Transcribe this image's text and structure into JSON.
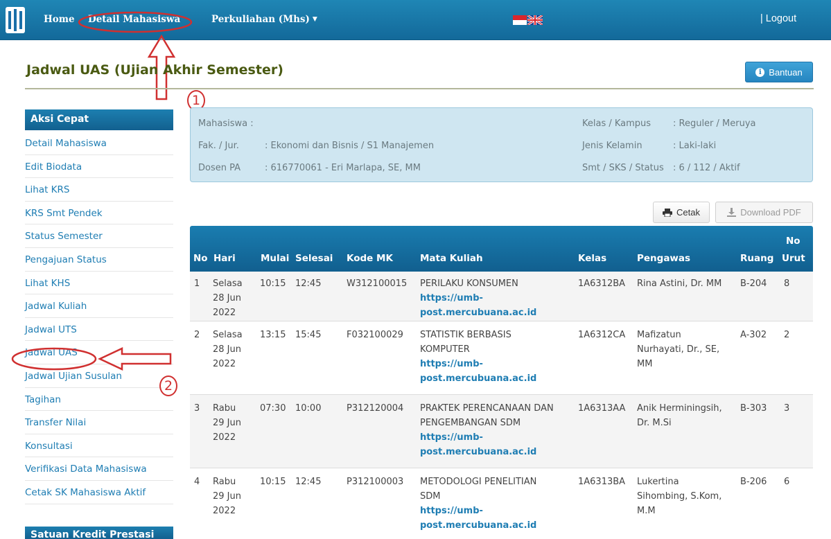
{
  "nav": {
    "home": "Home",
    "detail": "Detail Mahasiswa",
    "kuliah": "Perkuliahan (Mhs)",
    "logout": "| Logout"
  },
  "page": {
    "title": "Jadwal UAS (Ujian Akhir Semester)",
    "help": "Bantuan"
  },
  "annotations": {
    "one": "1",
    "two": "2"
  },
  "sidebar": {
    "heading": "Aksi Cepat",
    "items": [
      "Detail Mahasiswa",
      "Edit Biodata",
      "Lihat KRS",
      "KRS Smt Pendek",
      "Status Semester",
      "Pengajuan Status",
      "Lihat KHS",
      "Jadwal Kuliah",
      "Jadwal UTS",
      "Jadwal UAS",
      "Jadwal Ujian Susulan",
      "Tagihan",
      "Transfer Nilai",
      "Konsultasi",
      "Verifikasi Data Mahasiswa",
      "Cetak SK Mahasiswa Aktif"
    ],
    "heading2": "Satuan Kredit Prestasi"
  },
  "info": {
    "mahasiswa_lbl": "Mahasiswa  :",
    "fak_lbl": "Fak. / Jur.",
    "fak_val": ":  Ekonomi dan Bisnis / S1 Manajemen",
    "dosen_lbl": "Dosen PA",
    "dosen_val": ":  616770061 - Eri Marlapa, SE, MM",
    "kelas_lbl": "Kelas / Kampus",
    "kelas_val": ":  Reguler / Meruya",
    "jk_lbl": "Jenis Kelamin",
    "jk_val": ":  Laki-laki",
    "smt_lbl": "Smt / SKS / Status",
    "smt_val": ":  6 / 112 / Aktif"
  },
  "actions": {
    "cetak": "Cetak",
    "pdf": "Download PDF"
  },
  "table": {
    "headers": {
      "no": "No",
      "hari": "Hari",
      "mulai": "Mulai",
      "selesai": "Selesai",
      "kode": "Kode MK",
      "mk": "Mata Kuliah",
      "kelas": "Kelas",
      "pengawas": "Pengawas",
      "ruang": "Ruang",
      "nourut1": "No",
      "nourut2": "Urut"
    },
    "link": "https://umb-post.mercubuana.ac.id",
    "link_a": "https://umb-",
    "link_b": "post.mercubuana.ac.id",
    "rows": [
      {
        "no": "1",
        "hari": "Selasa",
        "tgl1": "28 Jun",
        "tgl2": "2022",
        "mulai": "10:15",
        "selesai": "12:45",
        "kode": "W312100015",
        "mk1": "PERILAKU KONSUMEN",
        "mk2": "",
        "kelas": "1A6312BA",
        "p1": "Rina Astini, Dr. MM",
        "p2": "",
        "p3": "",
        "ruang": "B-204",
        "urut": "8"
      },
      {
        "no": "2",
        "hari": "Selasa",
        "tgl1": "28 Jun",
        "tgl2": "2022",
        "mulai": "13:15",
        "selesai": "15:45",
        "kode": "F032100029",
        "mk1": "STATISTIK BERBASIS",
        "mk2": "KOMPUTER",
        "kelas": "1A6312CA",
        "p1": "Mafizatun",
        "p2": "Nurhayati, Dr., SE,",
        "p3": "MM",
        "ruang": "A-302",
        "urut": "2"
      },
      {
        "no": "3",
        "hari": "Rabu",
        "tgl1": "29 Jun",
        "tgl2": "2022",
        "mulai": "07:30",
        "selesai": "10:00",
        "kode": "P312120004",
        "mk1": "PRAKTEK PERENCANAAN DAN",
        "mk2": "PENGEMBANGAN SDM",
        "kelas": "1A6313AA",
        "p1": "Anik Herminingsih,",
        "p2": "Dr. M.Si",
        "p3": "",
        "ruang": "B-303",
        "urut": "3"
      },
      {
        "no": "4",
        "hari": "Rabu",
        "tgl1": "29 Jun",
        "tgl2": "2022",
        "mulai": "10:15",
        "selesai": "12:45",
        "kode": "P312100003",
        "mk1": "METODOLOGI PENELITIAN",
        "mk2": "SDM",
        "kelas": "1A6313BA",
        "p1": "Lukertina",
        "p2": "Sihombing, S.Kom,",
        "p3": "M.M",
        "ruang": "B-206",
        "urut": "6"
      }
    ]
  }
}
